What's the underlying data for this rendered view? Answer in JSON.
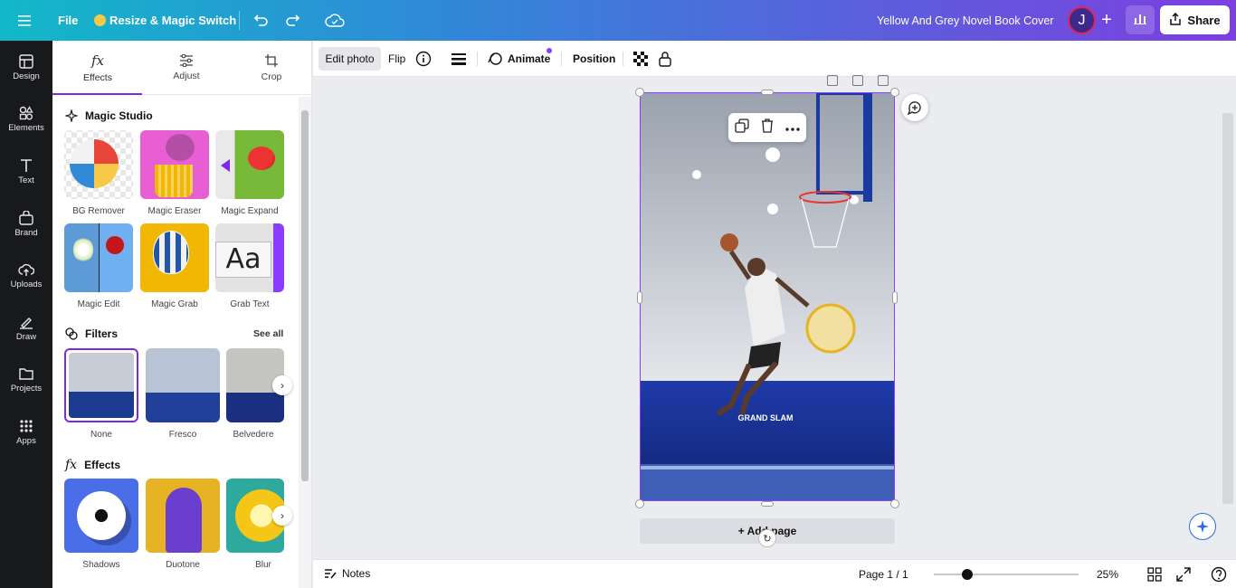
{
  "topbar": {
    "file_label": "File",
    "resize_label": "Resize & Magic Switch",
    "doc_title": "Yellow And Grey Novel Book Cover",
    "avatar_initial": "J",
    "share_label": "Share"
  },
  "rail": [
    {
      "label": "Design",
      "icon": "design-icon"
    },
    {
      "label": "Elements",
      "icon": "elements-icon"
    },
    {
      "label": "Text",
      "icon": "text-icon"
    },
    {
      "label": "Brand",
      "icon": "brand-icon"
    },
    {
      "label": "Uploads",
      "icon": "uploads-icon"
    },
    {
      "label": "Draw",
      "icon": "draw-icon"
    },
    {
      "label": "Projects",
      "icon": "projects-icon"
    },
    {
      "label": "Apps",
      "icon": "apps-icon"
    }
  ],
  "panel": {
    "tabs": [
      {
        "label": "Effects"
      },
      {
        "label": "Adjust"
      },
      {
        "label": "Crop"
      }
    ],
    "magic_studio": {
      "title": "Magic Studio",
      "tools": [
        "BG Remover",
        "Magic Eraser",
        "Magic Expand",
        "Magic Edit",
        "Magic Grab",
        "Grab Text"
      ]
    },
    "filters": {
      "title": "Filters",
      "see_all": "See all",
      "items": [
        "None",
        "Fresco",
        "Belvedere"
      ]
    },
    "effects": {
      "title": "Effects",
      "items": [
        "Shadows",
        "Duotone",
        "Blur"
      ]
    }
  },
  "context_toolbar": {
    "edit_photo": "Edit photo",
    "flip": "Flip",
    "animate": "Animate",
    "position": "Position"
  },
  "canvas": {
    "image_caption": "GRAND SLAM",
    "add_page": "+ Add page"
  },
  "bottombar": {
    "notes": "Notes",
    "page_indicator": "Page 1 / 1",
    "zoom": "25%",
    "zoom_fraction": 0.23
  },
  "colors": {
    "accent": "#7d2ae8",
    "topbar_start": "#12b8c8",
    "topbar_end": "#7c3fe0",
    "rail_bg": "#18191b"
  }
}
